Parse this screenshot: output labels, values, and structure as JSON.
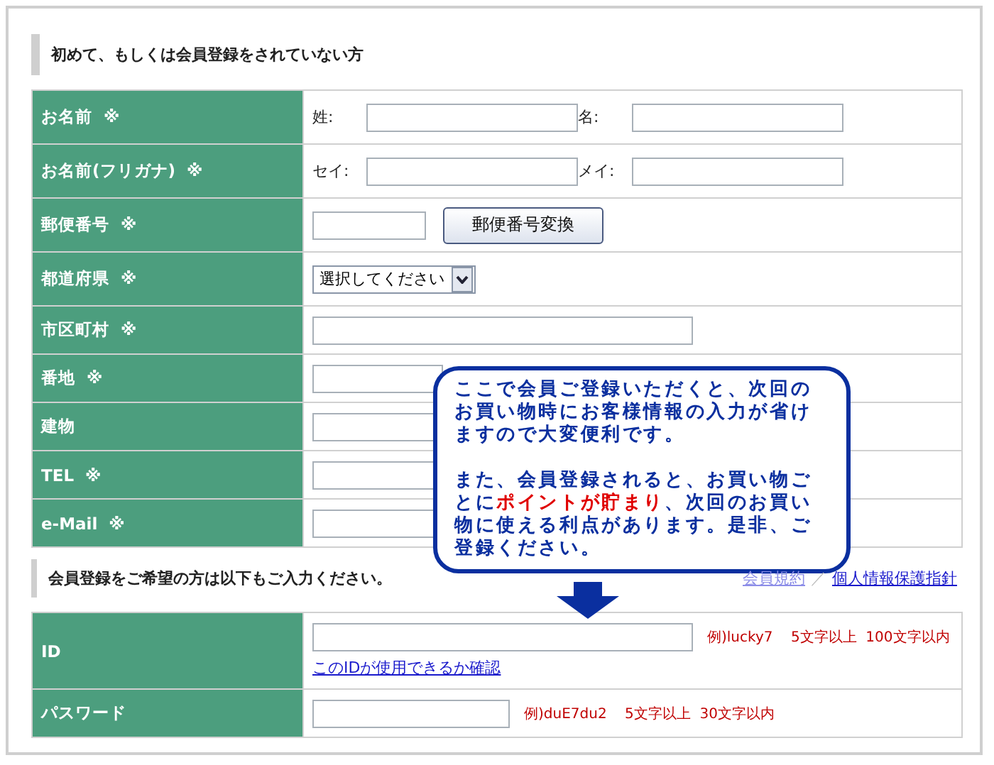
{
  "section_title": "初めて、もしくは会員登録をされていない方",
  "fields": [
    {
      "label": "お名前",
      "mark": "※",
      "kind": "pair",
      "parts": [
        {
          "prefix": "姓:"
        },
        {
          "prefix": "名:"
        }
      ]
    },
    {
      "label": "お名前(フリガナ)",
      "mark": "※",
      "kind": "pair",
      "parts": [
        {
          "prefix": "セイ:"
        },
        {
          "prefix": "メイ:"
        }
      ]
    },
    {
      "label": "郵便番号",
      "mark": "※",
      "kind": "zip",
      "button": "郵便番号変換"
    },
    {
      "label": "都道府県",
      "mark": "※",
      "kind": "select",
      "value": "選択してください"
    },
    {
      "label": "市区町村",
      "mark": "※",
      "kind": "text"
    },
    {
      "label": "番地",
      "mark": "※",
      "kind": "covered"
    },
    {
      "label": "建物",
      "kind": "covered"
    },
    {
      "label": "TEL",
      "mark": "※",
      "kind": "covered"
    },
    {
      "label": "e-Mail",
      "mark": "※",
      "kind": "covered"
    }
  ],
  "member_note": "会員登録をご希望の方は以下もご入力ください。",
  "links": [
    "会員規約",
    "個人情報保護指針"
  ],
  "link_separator": "／",
  "account_fields": [
    {
      "label": "ID",
      "kind": "long",
      "hint": "例)lucky7    5文字以上  100文字以内",
      "link": "このIDが使用できるか確認"
    },
    {
      "label": "パスワード",
      "kind": "short",
      "hint": "例)duE7du2    5文字以上  30文字以内"
    }
  ],
  "callout": {
    "paragraphs": [
      "ここで会員ご登録いただくと、次回のお買い物時にお客様情報の入力が省けますので大変便利です。",
      "また、会員登録されると、お買い物ごとに**ポイントが貯まり**、次回のお買い物に使える利点があります。是非、ご登録ください。"
    ]
  }
}
